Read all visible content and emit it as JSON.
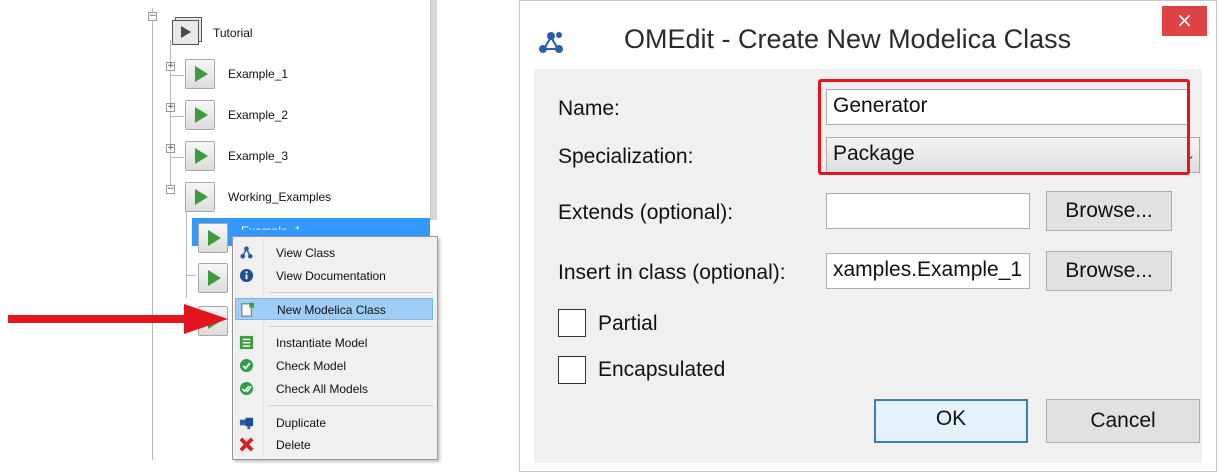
{
  "tree": {
    "items": [
      {
        "label": "Tutorial"
      },
      {
        "label": "Example_1"
      },
      {
        "label": "Example_2"
      },
      {
        "label": "Example_3"
      },
      {
        "label": "Working_Examples"
      },
      {
        "label": "Example_1"
      }
    ]
  },
  "context_menu": {
    "items": [
      {
        "label": "View Class",
        "icon": "view-class-icon"
      },
      {
        "label": "View Documentation",
        "icon": "info-icon"
      },
      {
        "label": "New Modelica Class",
        "icon": "new-class-icon"
      },
      {
        "label": "Instantiate Model",
        "icon": "instantiate-icon"
      },
      {
        "label": "Check Model",
        "icon": "check-icon"
      },
      {
        "label": "Check All Models",
        "icon": "check-all-icon"
      },
      {
        "label": "Duplicate",
        "icon": "duplicate-icon"
      },
      {
        "label": "Delete",
        "icon": "delete-icon"
      }
    ]
  },
  "dialog": {
    "title": "OMEdit - Create New Modelica Class",
    "close_label": "×",
    "name_label": "Name:",
    "name_value": "Generator",
    "specialization_label": "Specialization:",
    "specialization_value": "Package",
    "extends_label": "Extends (optional):",
    "extends_value": "",
    "insert_label": "Insert in class (optional):",
    "insert_value": "xamples.Example_1",
    "browse_label": "Browse...",
    "partial_label": "Partial",
    "encapsulated_label": "Encapsulated",
    "ok_label": "OK",
    "cancel_label": "Cancel"
  },
  "colors": {
    "highlight_red": "#e3161f",
    "selection_blue": "#3399ff",
    "menu_highlight": "#9fcdf5",
    "play_green": "#3d9c3d"
  }
}
